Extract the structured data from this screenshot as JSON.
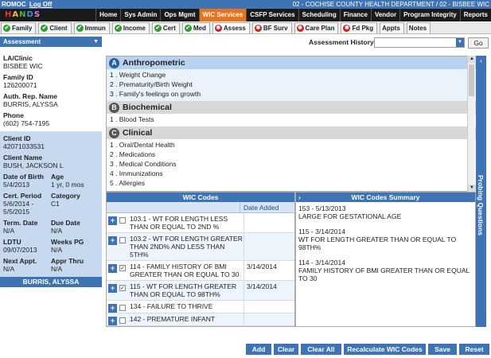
{
  "topbar": {
    "app_name": "ROMOC",
    "logoff": "Log Off",
    "department": "02 - COCHISE COUNTY HEALTH DEPARTMENT / 02 - BISBEE WIC"
  },
  "logo": {
    "letters": [
      "H",
      "A",
      "N",
      "D",
      "S"
    ],
    "colors": [
      "#e23b2e",
      "#f1c232",
      "#4caf50",
      "#3f8fd8",
      "#e87ddc"
    ]
  },
  "nav": {
    "items": [
      "Home",
      "Sys Admin",
      "Ops Mgmt",
      "WIC Services",
      "CSFP Services",
      "Scheduling",
      "Finance",
      "Vendor",
      "Program Integrity",
      "Reports"
    ],
    "active": "WIC Services"
  },
  "tabs": [
    {
      "label": "Family",
      "icon": "check"
    },
    {
      "label": "Client",
      "icon": "check"
    },
    {
      "label": "Immun",
      "icon": "check"
    },
    {
      "label": "Income",
      "icon": "check"
    },
    {
      "label": "Cert",
      "icon": "check"
    },
    {
      "label": "Med",
      "icon": "check"
    },
    {
      "label": "Assess",
      "icon": "star"
    },
    {
      "label": "BF Surv",
      "icon": "star"
    },
    {
      "label": "Care Plan",
      "icon": "star"
    },
    {
      "label": "Fd Pkg",
      "icon": "star"
    },
    {
      "label": "Appts",
      "icon": "none"
    },
    {
      "label": "Notes",
      "icon": "none"
    }
  ],
  "assessment": {
    "header": "Assessment",
    "history_label": "Assessment History:",
    "history_value": "",
    "go_label": "Go"
  },
  "client": {
    "la_clinic_label": "LA/Clinic",
    "la_clinic": "BISBEE WIC",
    "family_id_label": "Family ID",
    "family_id": "126200071",
    "auth_rep_label": "Auth. Rep. Name",
    "auth_rep": "BURRIS, ALYSSA",
    "phone_label": "Phone",
    "phone": "(602) 754-7195",
    "client_id_label": "Client ID",
    "client_id": "42071033531",
    "client_name_label": "Client Name",
    "client_name": "BUSH, JACKSON L",
    "dob_label": "Date of Birth",
    "dob": "5/4/2013",
    "age_label": "Age",
    "age": "1 yr, 0 mos",
    "cert_label": "Cert. Period",
    "cert": "5/6/2014 - 5/5/2015",
    "category_label": "Category",
    "category": "C1",
    "term_label": "Term. Date",
    "term": "N/A",
    "due_label": "Due Date",
    "due": "N/A",
    "ldtu_label": "LDTU",
    "ldtu": "09/07/2013",
    "weeks_label": "Weeks PG",
    "weeks": "N/A",
    "next_label": "Next Appt.",
    "next": "N/A",
    "appr_label": "Appr Thru",
    "appr": "N/A",
    "footer": "BURRIS, ALYSSA"
  },
  "categories": [
    {
      "letter": "A",
      "title": "Anthropometric",
      "items": [
        "1 . Weight Change",
        "2 . Prematurity/Birth Weight",
        "3 . Family's feelings on growth"
      ]
    },
    {
      "letter": "B",
      "title": "Biochemical",
      "items": [
        "1 . Blood Tests"
      ]
    },
    {
      "letter": "C",
      "title": "Clinical",
      "items": [
        "1 . Oral/Dental Health",
        "2 . Medications",
        "3 . Medical Conditions",
        "4 . Immunizations",
        "5 . Allergies"
      ]
    }
  ],
  "probing": {
    "label": "Probing Questions"
  },
  "wic_codes": {
    "title": "WIC Codes",
    "date_header": "Date Added",
    "rows": [
      {
        "code": "103.1 - WT FOR LENGTH LESS THAN OR EQUAL TO 2ND %",
        "date": "",
        "checked": false
      },
      {
        "code": "103.2 - WT FOR LENGTH GREATER THAN 2ND% AND LESS THAN 5TH%",
        "date": "",
        "checked": false
      },
      {
        "code": "114 - FAMILY HISTORY OF BMI GREATER THAN OR EQUAL TO 30",
        "date": "3/14/2014",
        "checked": true
      },
      {
        "code": "115 - WT FOR LENGTH GREATER THAN OR EQUAL TO 98TH%",
        "date": "3/14/2014",
        "checked": true
      },
      {
        "code": "134 - FAILURE TO THRIVE",
        "date": "",
        "checked": false
      },
      {
        "code": "142 - PREMATURE INFANT",
        "date": "",
        "checked": false
      }
    ]
  },
  "summary": {
    "title": "WIC Codes Summary",
    "entries": [
      {
        "head": "153 - 5/13/2013",
        "text": "LARGE FOR GESTATIONAL AGE"
      },
      {
        "head": "115 - 3/14/2014",
        "text": "WT FOR LENGTH GREATER THAN OR EQUAL TO 98TH%"
      },
      {
        "head": "114 - 3/14/2014",
        "text": "FAMILY HISTORY OF BMI GREATER THAN OR EQUAL TO 30"
      }
    ]
  },
  "buttons": [
    "Add",
    "Clear",
    "Clear All",
    "Recalculate WIC Codes",
    "Save",
    "Reset"
  ]
}
